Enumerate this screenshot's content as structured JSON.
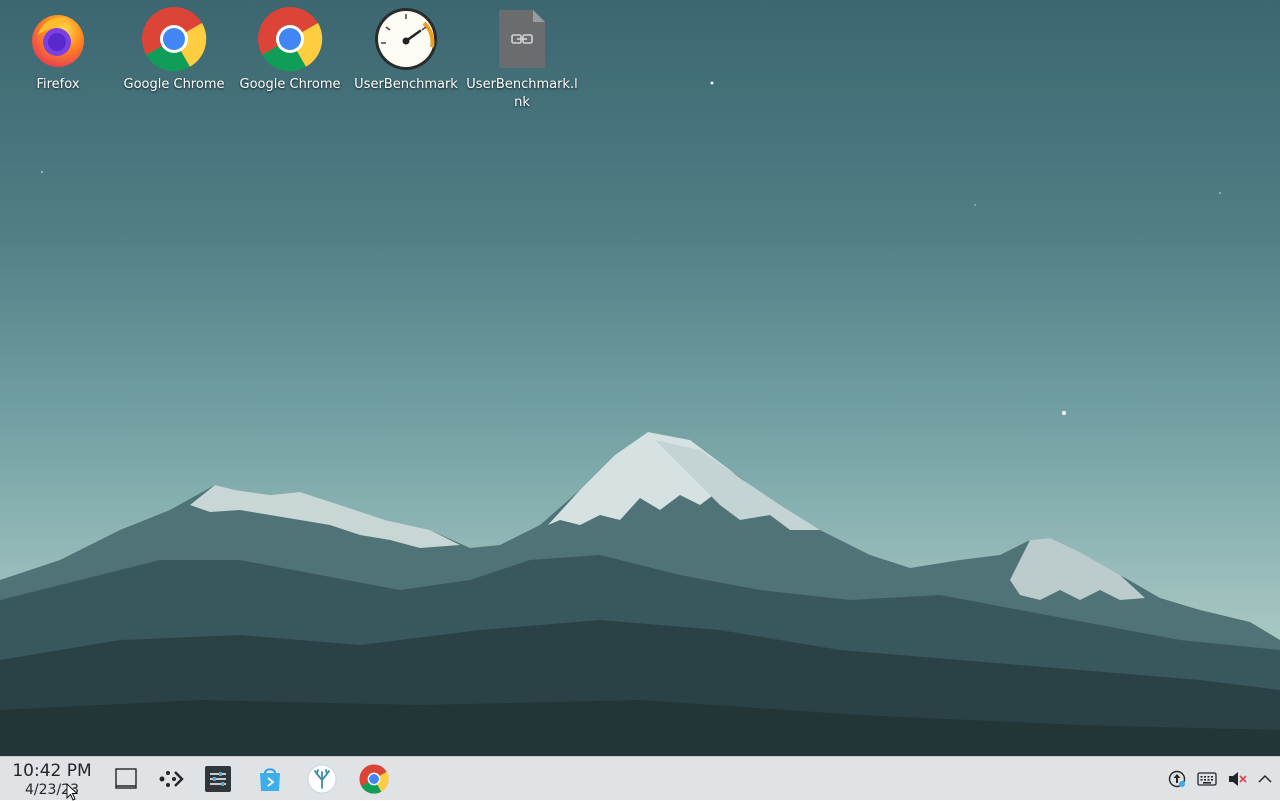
{
  "desktop": {
    "icons": [
      {
        "label": "Firefox",
        "icon": "firefox-icon"
      },
      {
        "label": "Google Chrome",
        "icon": "chrome-icon"
      },
      {
        "label": "Google Chrome",
        "icon": "chrome-icon"
      },
      {
        "label": "UserBenchmark",
        "icon": "speedometer-icon"
      },
      {
        "label": "UserBenchmark.lnk",
        "icon": "link-file-icon"
      }
    ]
  },
  "taskbar": {
    "clock": {
      "time": "10:42 PM",
      "date": "4/23/23"
    },
    "launchers": [
      {
        "name": "show-desktop",
        "icon": "show-desktop-icon"
      },
      {
        "name": "kdeconnect",
        "icon": "kdeconnect-icon"
      },
      {
        "name": "system-settings",
        "icon": "settings-sliders-icon"
      },
      {
        "name": "discover-store",
        "icon": "store-bag-icon"
      },
      {
        "name": "app-menu",
        "icon": "coral-app-icon"
      },
      {
        "name": "google-chrome",
        "icon": "chrome-icon"
      }
    ],
    "tray": [
      {
        "name": "updates",
        "icon": "update-arrow-icon"
      },
      {
        "name": "keyboard",
        "icon": "keyboard-icon"
      },
      {
        "name": "volume",
        "icon": "volume-muted-icon"
      },
      {
        "name": "expand-tray",
        "icon": "chevron-up-icon"
      }
    ]
  },
  "colors": {
    "sky_top": "#3c6670",
    "sky_bottom": "#c3dad3",
    "taskbar_bg": "#dfe3e6",
    "text_dark": "#232629"
  }
}
